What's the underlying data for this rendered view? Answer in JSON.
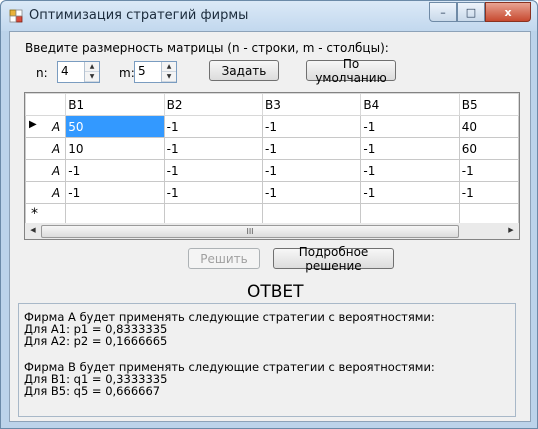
{
  "window": {
    "title": "Оптимизация стратегий фирмы",
    "buttons": [
      "–",
      "□",
      "x"
    ]
  },
  "dimensions": {
    "prompt": "Введите размерность матрицы (n - строки, m - столбцы):",
    "n_label": "n:",
    "n_value": "4",
    "m_label": "m:",
    "m_value": "5",
    "set_button": "Задать",
    "default_button": "По умолчанию"
  },
  "grid": {
    "columns": [
      "B1",
      "B2",
      "B3",
      "B4",
      "B5"
    ],
    "rows": [
      {
        "head": "A",
        "cells": [
          "50",
          "-1",
          "-1",
          "-1",
          "40"
        ]
      },
      {
        "head": "A",
        "cells": [
          "10",
          "-1",
          "-1",
          "-1",
          "60"
        ]
      },
      {
        "head": "A",
        "cells": [
          "-1",
          "-1",
          "-1",
          "-1",
          "-1"
        ]
      },
      {
        "head": "A",
        "cells": [
          "-1",
          "-1",
          "-1",
          "-1",
          "-1"
        ]
      }
    ],
    "current_row_marker": "▶",
    "new_row_marker": "*",
    "scroll_thumb_label": "III"
  },
  "actions": {
    "solve_button": "Решить",
    "detailed_button": "Подробное решение"
  },
  "answer": {
    "title": "ОТВЕТ",
    "lines": [
      "Фирма А будет применять следующие стратегии с вероятностями:",
      "Для А1: p1 = 0,8333335",
      "Для А2: p2 = 0,1666665",
      "",
      "Фирма В будет применять следующие стратегии с вероятностями:",
      "Для В1: q1 = 0,3333335",
      "Для В5: q5 = 0,666667"
    ]
  },
  "colors": {
    "selection": "#3399ff",
    "frame": "#bcd3ea"
  }
}
